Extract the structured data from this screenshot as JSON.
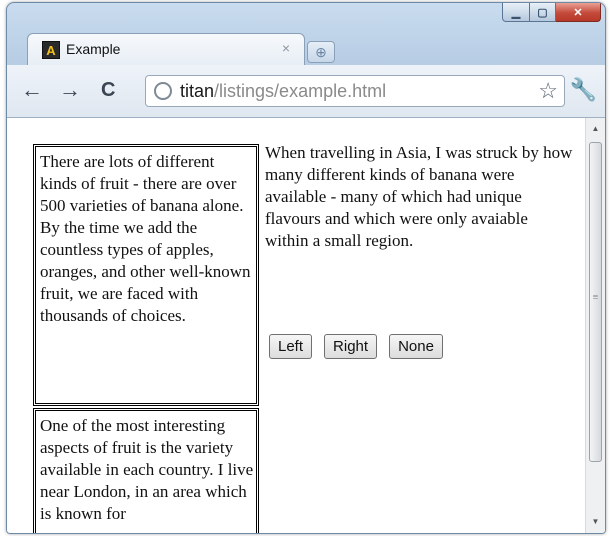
{
  "tab": {
    "favicon_letter": "A",
    "title": "Example",
    "close": "×"
  },
  "toolbar": {
    "back": "←",
    "forward": "→",
    "reload": "C",
    "url_host": "titan",
    "url_path": "/listings/example.html",
    "star": "☆",
    "wrench": "🔧"
  },
  "content": {
    "box1_text": "There are lots of different kinds of fruit - there are over 500 varieties of banana alone. By the time we add the countless types of apples, oranges, and other well-known fruit, we are faced with thousands of choices.",
    "box2_text": "One of the most interesting aspects of fruit is the variety available in each country. I live near London, in an area which is known for",
    "main_text": "When travelling in Asia, I was struck by how many different kinds of banana were available - many of which had unique flavours and which were only avaiable within a small region.",
    "buttons": [
      "Left",
      "Right",
      "None"
    ]
  }
}
